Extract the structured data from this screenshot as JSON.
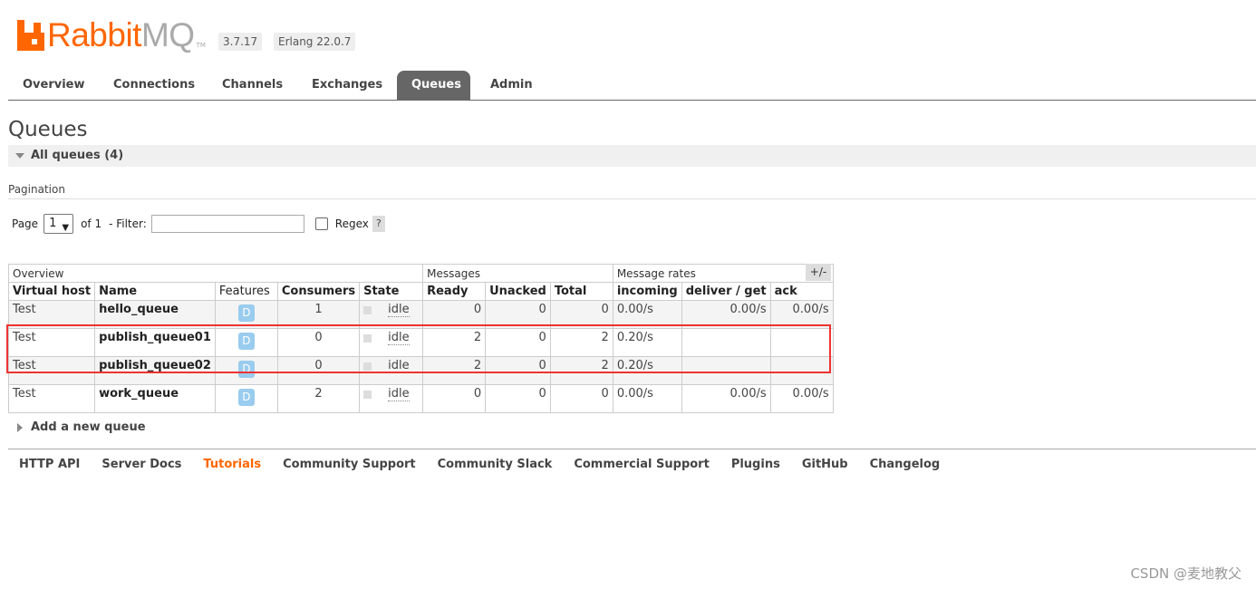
{
  "header": {
    "logo_rabbit": "Rabbit",
    "logo_mq": "MQ",
    "logo_tm": "TM",
    "version": "3.7.17",
    "erlang": "Erlang 22.0.7"
  },
  "tabs": [
    {
      "label": "Overview",
      "active": false
    },
    {
      "label": "Connections",
      "active": false
    },
    {
      "label": "Channels",
      "active": false
    },
    {
      "label": "Exchanges",
      "active": false
    },
    {
      "label": "Queues",
      "active": true
    },
    {
      "label": "Admin",
      "active": false
    }
  ],
  "page": {
    "title": "Queues",
    "section": "All queues (4)",
    "pagination_label": "Pagination",
    "page_label": "Page",
    "page_value": "1",
    "of_label": "of 1",
    "filter_label": "- Filter:",
    "filter_value": "",
    "regex_label": "Regex",
    "help": "?",
    "plusminus": "+/-",
    "add_queue": "Add a new queue"
  },
  "table": {
    "groups": {
      "overview": "Overview",
      "messages": "Messages",
      "rates": "Message rates"
    },
    "columns": [
      "Virtual host",
      "Name",
      "Features",
      "Consumers",
      "State",
      "Ready",
      "Unacked",
      "Total",
      "incoming",
      "deliver / get",
      "ack"
    ],
    "rows": [
      {
        "vhost": "Test",
        "name": "hello_queue",
        "feature": "D",
        "consumers": "1",
        "state": "idle",
        "ready": "0",
        "unacked": "0",
        "total": "0",
        "incoming": "0.00/s",
        "deliver": "0.00/s",
        "ack": "0.00/s"
      },
      {
        "vhost": "Test",
        "name": "publish_queue01",
        "feature": "D",
        "consumers": "0",
        "state": "idle",
        "ready": "2",
        "unacked": "0",
        "total": "2",
        "incoming": "0.20/s",
        "deliver": "",
        "ack": ""
      },
      {
        "vhost": "Test",
        "name": "publish_queue02",
        "feature": "D",
        "consumers": "0",
        "state": "idle",
        "ready": "2",
        "unacked": "0",
        "total": "2",
        "incoming": "0.20/s",
        "deliver": "",
        "ack": ""
      },
      {
        "vhost": "Test",
        "name": "work_queue",
        "feature": "D",
        "consumers": "2",
        "state": "idle",
        "ready": "0",
        "unacked": "0",
        "total": "0",
        "incoming": "0.00/s",
        "deliver": "0.00/s",
        "ack": "0.00/s"
      }
    ]
  },
  "footer": [
    "HTTP API",
    "Server Docs",
    "Tutorials",
    "Community Support",
    "Community Slack",
    "Commercial Support",
    "Plugins",
    "GitHub",
    "Changelog"
  ],
  "footer_highlight": "Tutorials",
  "watermark": "CSDN @麦地教父",
  "colors": {
    "brand": "#ff6600",
    "active_tab": "#666666",
    "highlight_box": "#e33333",
    "feature_badge": "#99ccee"
  }
}
